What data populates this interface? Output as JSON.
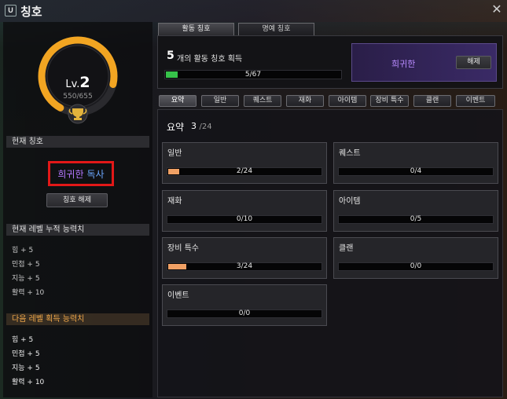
{
  "window": {
    "key": "U",
    "title": "칭호"
  },
  "level": {
    "prefix": "Lv.",
    "value": "2",
    "exp": "550/655",
    "progress": 0.84,
    "ring_color": "#f2a522"
  },
  "current_title": {
    "heading": "현재 칭호",
    "rarity": "희귀한",
    "name": "독사",
    "unequip_label": "칭호 해제"
  },
  "current_stats": {
    "heading": "현재 레벨 누적 능력치",
    "items": [
      "힘 + 5",
      "민첩 + 5",
      "지능 + 5",
      "활력 + 10"
    ]
  },
  "next_stats": {
    "heading": "다음 레벨 획득 능력치",
    "items": [
      "힘 + 5",
      "민첩 + 5",
      "지능 + 5",
      "활력 + 10"
    ]
  },
  "top_tabs": [
    "활동 칭호",
    "명예 칭호"
  ],
  "summary": {
    "count": "5",
    "label": "개의 활동 칭호 획득",
    "progress_text": "5/67",
    "progress": 0.075,
    "progress_color": "#36c24a"
  },
  "equipped": {
    "rarity": "희귀한",
    "unequip_label": "해제"
  },
  "category_tabs": [
    "요약",
    "일반",
    "퀘스트",
    "재화",
    "아이템",
    "장비 특수",
    "클랜",
    "이벤트"
  ],
  "overview": {
    "title": "요약",
    "count": "3",
    "total": "/24"
  },
  "categories": [
    {
      "name": "일반",
      "progress_text": "2/24",
      "progress": 0.083
    },
    {
      "name": "퀘스트",
      "progress_text": "0/4",
      "progress": 0
    },
    {
      "name": "재화",
      "progress_text": "0/10",
      "progress": 0
    },
    {
      "name": "아이템",
      "progress_text": "0/5",
      "progress": 0
    },
    {
      "name": "장비 특수",
      "progress_text": "3/24",
      "progress": 0.125
    },
    {
      "name": "클랜",
      "progress_text": "0/0",
      "progress": 0
    },
    {
      "name": "이벤트",
      "progress_text": "0/0",
      "progress": 0
    }
  ],
  "colors": {
    "category_fill": "#f0a064",
    "accent_purple": "#b98bff",
    "highlight_red": "#e21818"
  }
}
